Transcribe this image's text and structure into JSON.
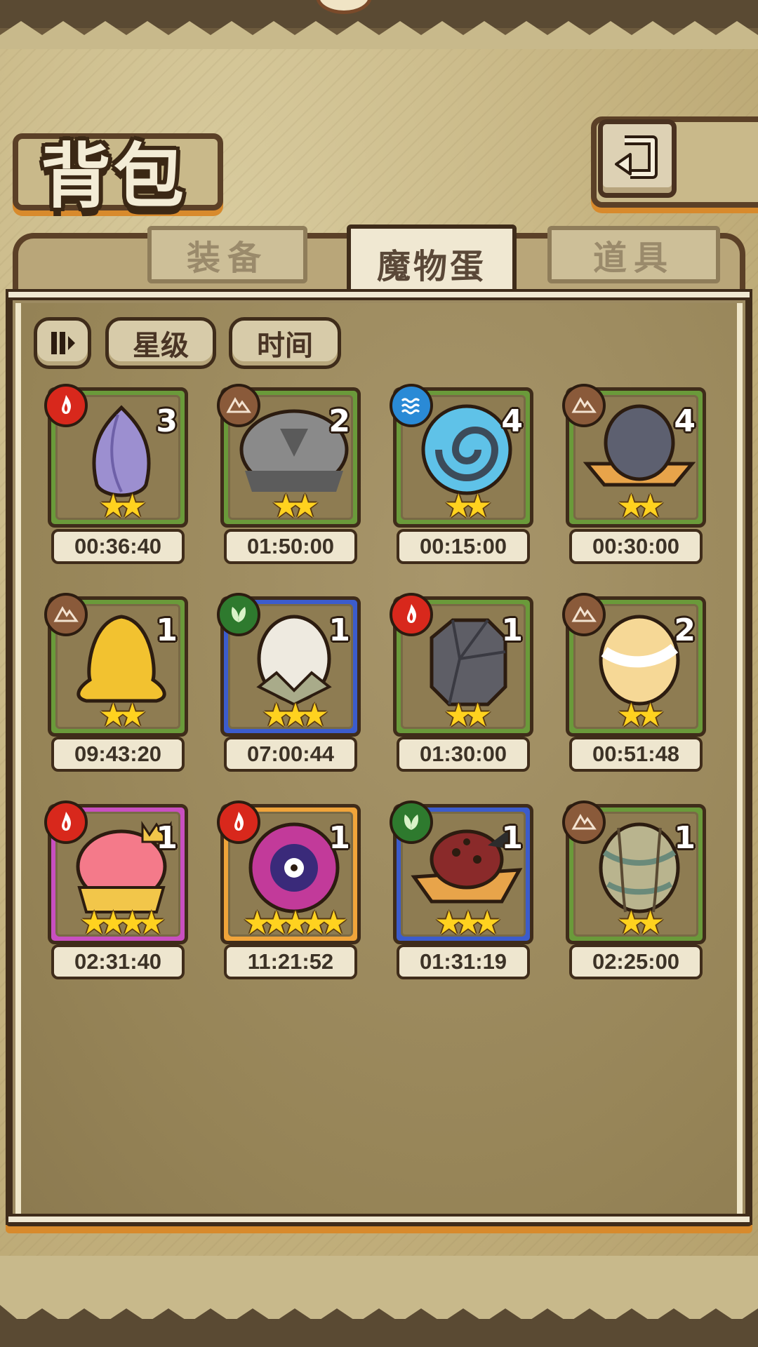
{
  "header": {
    "title": "背包",
    "back_icon": "return-arrow-icon"
  },
  "tabs": [
    {
      "label": "装备",
      "active": false
    },
    {
      "label": "魔物蛋",
      "active": true
    },
    {
      "label": "道具",
      "active": false
    }
  ],
  "filters": {
    "toggle_icon": "pause-sort-icon",
    "star_label": "星级",
    "time_label": "时间"
  },
  "colors": {
    "green_frame": "#6a9a3a",
    "blue_frame": "#3c5ccc",
    "purple_frame": "#c84fc0",
    "orange_frame": "#f0a43a",
    "fire": "#d8281c",
    "earth": "#8a5a3a",
    "water": "#2a8ad6",
    "grass": "#2e7a2e"
  },
  "eggs": [
    {
      "count": "3",
      "stars": "★★",
      "time": "00:36:40",
      "element": "fire",
      "frame": "green",
      "egg": "purple-flower-egg"
    },
    {
      "count": "2",
      "stars": "★★",
      "time": "01:50:00",
      "element": "earth",
      "frame": "green",
      "egg": "gray-mop-egg"
    },
    {
      "count": "4",
      "stars": "★★",
      "time": "00:15:00",
      "element": "water",
      "frame": "green",
      "egg": "blue-spiral-shell-egg"
    },
    {
      "count": "4",
      "stars": "★★",
      "time": "00:30:00",
      "element": "earth",
      "frame": "green",
      "egg": "gray-hat-egg"
    },
    {
      "count": "1",
      "stars": "★★",
      "time": "09:43:20",
      "element": "earth",
      "frame": "green",
      "egg": "golden-slime-egg"
    },
    {
      "count": "1",
      "stars": "★★★",
      "time": "07:00:44",
      "element": "grass",
      "frame": "blue",
      "egg": "white-lotus-egg"
    },
    {
      "count": "1",
      "stars": "★★",
      "time": "01:30:00",
      "element": "fire",
      "frame": "green",
      "egg": "stone-golem-egg"
    },
    {
      "count": "2",
      "stars": "★★",
      "time": "00:51:48",
      "element": "earth",
      "frame": "green",
      "egg": "cream-swirl-egg"
    },
    {
      "count": "1",
      "stars": "★★★★",
      "time": "02:31:40",
      "element": "fire",
      "frame": "purple",
      "egg": "pink-crown-egg"
    },
    {
      "count": "1",
      "stars": "★★★★★",
      "time": "11:21:52",
      "element": "fire",
      "frame": "orange",
      "egg": "magenta-eye-orb-egg"
    },
    {
      "count": "1",
      "stars": "★★★",
      "time": "01:31:19",
      "element": "grass",
      "frame": "blue",
      "egg": "spotted-feather-hat-egg"
    },
    {
      "count": "1",
      "stars": "★★",
      "time": "02:25:00",
      "element": "earth",
      "frame": "green",
      "egg": "wrapped-cocoon-egg"
    }
  ]
}
